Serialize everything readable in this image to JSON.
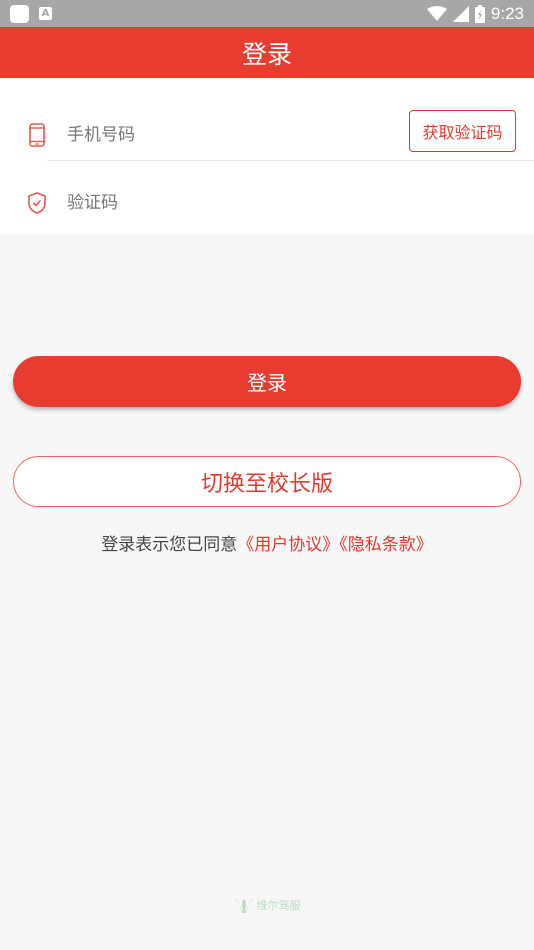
{
  "statusbar": {
    "time": "9:23",
    "a_label": "A"
  },
  "header": {
    "title": "登录"
  },
  "form": {
    "phone_placeholder": "手机号码",
    "code_placeholder": "验证码",
    "get_code_label": "获取验证码"
  },
  "actions": {
    "login_label": "登录",
    "switch_label": "切换至校长版"
  },
  "agreement": {
    "prefix": "登录表示您已同意",
    "user_agreement": "《用户协议》",
    "privacy_policy": "《隐私条款》"
  },
  "footer": {
    "brand": "维尔驾服"
  },
  "colors": {
    "accent": "#e83c30",
    "statusbar": "#a7a7a7",
    "background": "#f7f7f7"
  },
  "icons": [
    "phone-icon",
    "shield-icon",
    "wifi-icon",
    "signal-icon",
    "battery-icon"
  ]
}
